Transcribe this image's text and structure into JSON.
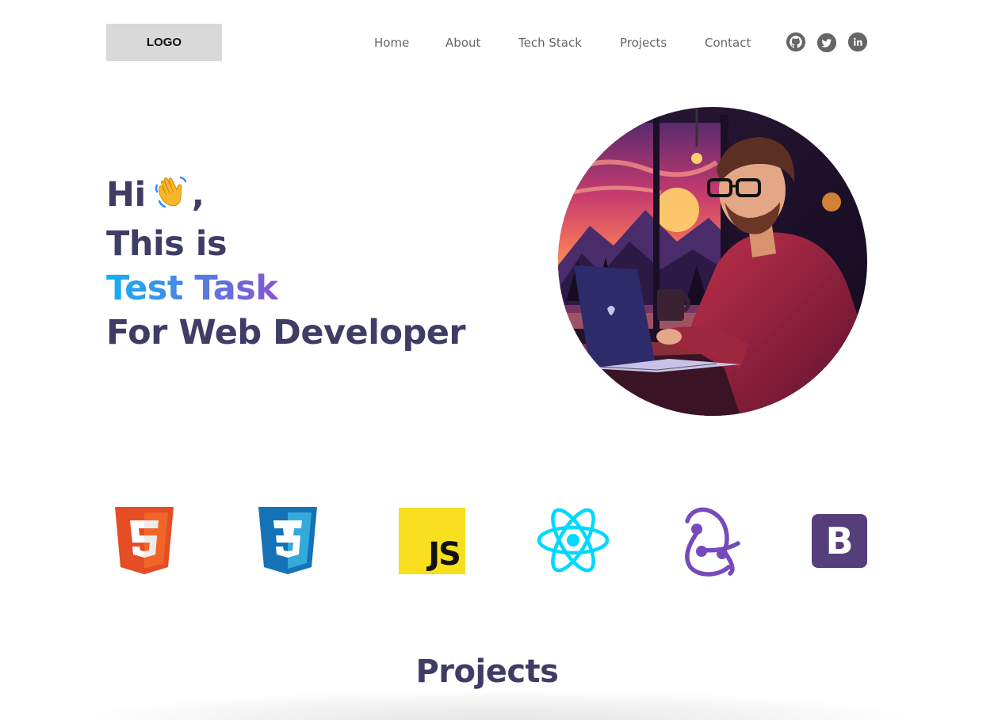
{
  "header": {
    "logo": "LOGO",
    "nav": [
      {
        "label": "Home"
      },
      {
        "label": "About"
      },
      {
        "label": "Tech Stack"
      },
      {
        "label": "Projects"
      },
      {
        "label": "Contact"
      }
    ],
    "social": [
      {
        "icon": "github-icon"
      },
      {
        "icon": "twitter-icon"
      },
      {
        "icon": "linkedin-icon"
      }
    ]
  },
  "hero": {
    "line1": "Hi",
    "line1_suffix": ",",
    "line2": "This is",
    "line3": "Test Task",
    "line4": "For Web Developer",
    "avatar_icon": "developer-illustration"
  },
  "tech_stack": [
    {
      "icon": "html5-icon",
      "color": "#e44d26"
    },
    {
      "icon": "css3-icon",
      "color": "#1572b6"
    },
    {
      "icon": "javascript-icon",
      "color": "#f7df1e",
      "text": "JS"
    },
    {
      "icon": "react-icon",
      "color": "#00d8ff"
    },
    {
      "icon": "redux-icon",
      "color": "#764abc"
    },
    {
      "icon": "bootstrap-icon",
      "color": "#563d7c",
      "text": "B"
    }
  ],
  "projects": {
    "title": "Projects"
  },
  "colors": {
    "heading": "#3d3d66",
    "nav_text": "#666666",
    "logo_bg": "#d9d9d9",
    "gradient": [
      "#13b0f5",
      "#e70faa"
    ]
  }
}
